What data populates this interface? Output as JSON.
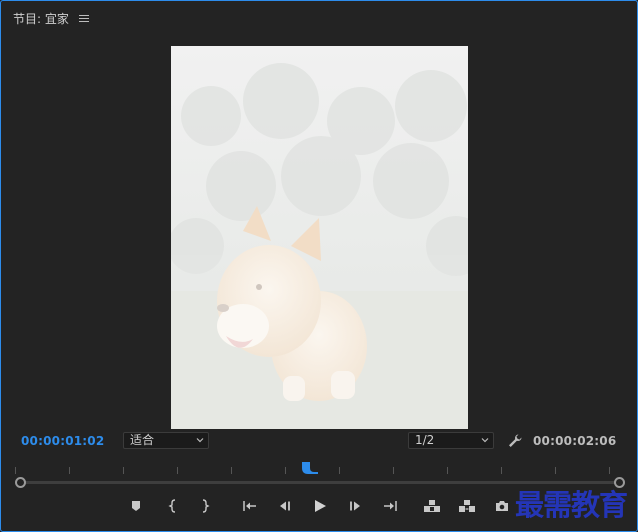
{
  "panel": {
    "title": "节目: 宜家",
    "menu_icon": "hamburger-menu-icon"
  },
  "viewer": {
    "content": "corgi-dog-photo"
  },
  "timecodes": {
    "current": "00:00:01:02",
    "duration": "00:00:02:06"
  },
  "zoom_select": {
    "value": "适合"
  },
  "resolution_select": {
    "value": "1/2"
  },
  "settings_icon": "wrench-icon",
  "transport": [
    {
      "name": "add-marker-button",
      "icon": "marker-icon"
    },
    {
      "name": "mark-in-button",
      "icon": "mark-in-icon"
    },
    {
      "name": "mark-out-button",
      "icon": "mark-out-icon"
    },
    {
      "name": "go-to-in-button",
      "icon": "go-to-in-icon"
    },
    {
      "name": "step-back-button",
      "icon": "step-back-icon"
    },
    {
      "name": "play-button",
      "icon": "play-icon"
    },
    {
      "name": "step-forward-button",
      "icon": "step-forward-icon"
    },
    {
      "name": "go-to-out-button",
      "icon": "go-to-out-icon"
    },
    {
      "name": "lift-button",
      "icon": "lift-icon"
    },
    {
      "name": "extract-button",
      "icon": "extract-icon"
    },
    {
      "name": "export-frame-button",
      "icon": "camera-icon"
    }
  ],
  "watermark": "最需教育",
  "colors": {
    "accent": "#2d8ceb",
    "panel_bg": "#232323",
    "watermark": "#2435b7"
  }
}
